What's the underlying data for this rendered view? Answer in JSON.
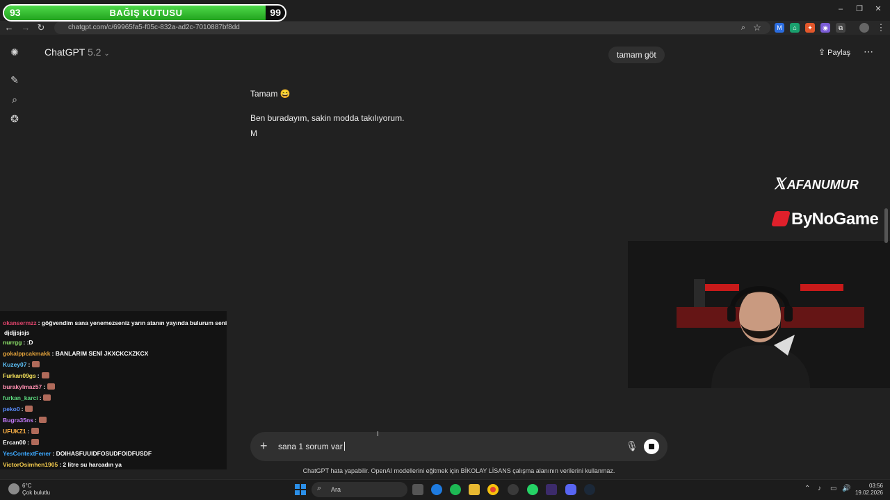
{
  "browser": {
    "url": "chatgpt.com/c/69965fa5-f05c-832a-ad2c-7010887bf8dd",
    "back_icon": "arrow-left",
    "forward_icon": "arrow-right",
    "reload_icon": "reload"
  },
  "donation": {
    "left_number": "93",
    "title": "BAĞIŞ KUTUSU",
    "right_number": "99",
    "progress": 0.93,
    "fill_color": "#2fbf2a"
  },
  "sidebar": {
    "items": [
      "openai-logo",
      "new-chat",
      "search",
      "library"
    ]
  },
  "header": {
    "model_name": "ChatGPT",
    "model_version": "5.2",
    "pill_text": "tamam göt",
    "share_label": "Paylaş"
  },
  "messages": {
    "line1": "Tamam 😄",
    "line2": "Ben buradayım, sakin modda takılıyorum.",
    "line3": "M"
  },
  "brands": {
    "x_handle": "AFANUMUR",
    "sponsor": "ByNoGame"
  },
  "chat": {
    "rows": [
      {
        "user": "okansermzz",
        "color": "#e0446c",
        "msg": ": göğvendim sana yenemezseniz yarın atanın yayında bulurum seni"
      },
      {
        "user": "",
        "color": "#ffffff",
        "msg": "djdjjsjsjs"
      },
      {
        "user": "nurrgg",
        "color": "#8de36a",
        "msg": ": :D"
      },
      {
        "user": "gokalppcakmakk",
        "color": "#e0a03a",
        "msg": ": BANLARIM SENİ JKXCKCXZKCX"
      },
      {
        "user": "Kuzey07",
        "color": "#5fc6ff",
        "msg": ":"
      },
      {
        "user": "Furkan09gs",
        "color": "#f6e25a",
        "msg": ":"
      },
      {
        "user": "burakylmaz57",
        "color": "#ff8fb0",
        "msg": ":"
      },
      {
        "user": "furkan_karci",
        "color": "#5bd67d",
        "msg": ":"
      },
      {
        "user": "peko0",
        "color": "#5a8dff",
        "msg": ":"
      },
      {
        "user": "Bugra35ns",
        "color": "#c77dff",
        "msg": ":"
      },
      {
        "user": "UFUKZ1",
        "color": "#ffb347",
        "msg": ":"
      },
      {
        "user": "Ercan00",
        "color": "#ffffff",
        "msg": ":"
      },
      {
        "user": "YesContextFener",
        "color": "#3da9ff",
        "msg": ": DOIHASFUUIDFOSUDFOIDFUSDF"
      },
      {
        "user": "VictorOsimhen1905",
        "color": "#f2c94c",
        "msg": ": 2 litre su harcadın ya"
      }
    ]
  },
  "composer": {
    "text": "sana 1 sorum var",
    "plus_icon": "plus",
    "mic_icon": "microphone",
    "stop_icon": "stop"
  },
  "disclaimer": "ChatGPT hata yapabilir. OpenAI modellerini eğitmek için BİKOLAY LİSANS çalışma alanının verilerini kullanmaz.",
  "taskbar": {
    "weather_temp": "6°C",
    "weather_desc": "Çok bulutlu",
    "search_placeholder": "Ara",
    "time": "03:56",
    "date": "19.02.2026"
  }
}
